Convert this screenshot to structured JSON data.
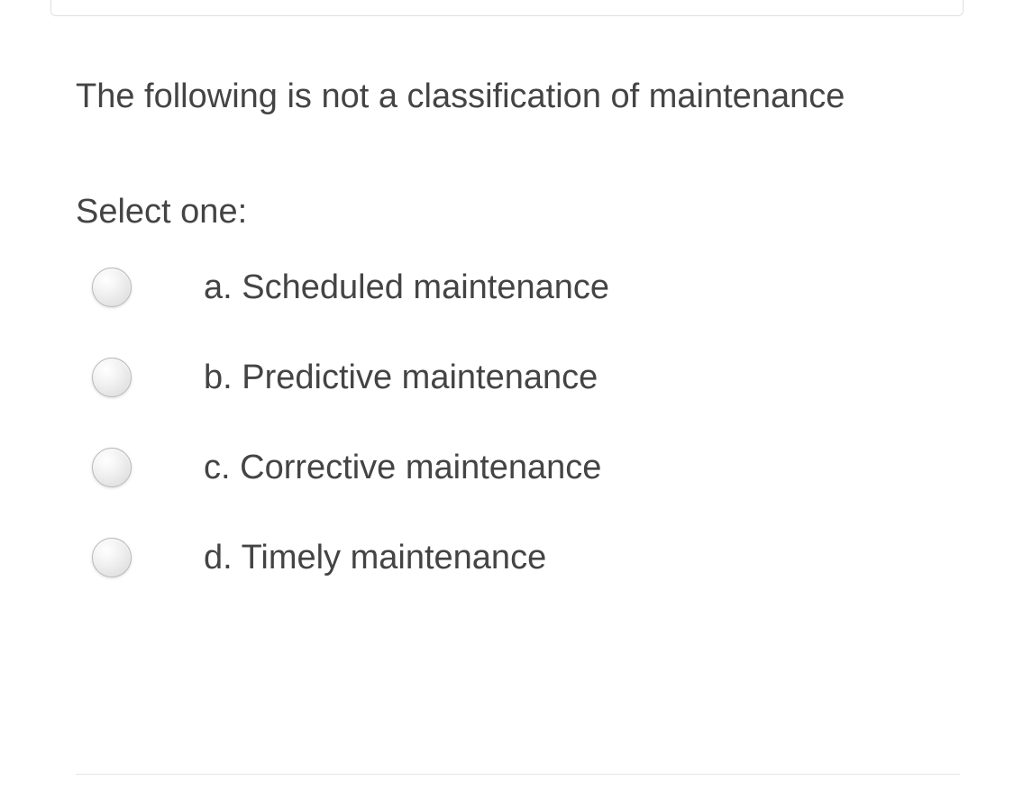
{
  "question": {
    "text": "The following is not a classification of maintenance",
    "prompt": "Select one:",
    "options": [
      {
        "letter": "a.",
        "text": "Scheduled maintenance"
      },
      {
        "letter": "b.",
        "text": "Predictive maintenance"
      },
      {
        "letter": "c.",
        "text": "Corrective maintenance"
      },
      {
        "letter": "d.",
        "text": "Timely maintenance"
      }
    ]
  }
}
